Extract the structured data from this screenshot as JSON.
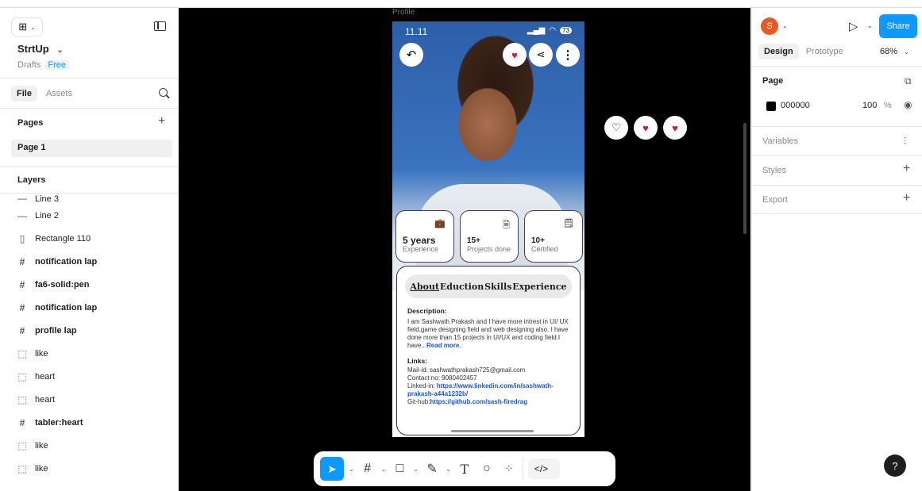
{
  "left_panel": {
    "project_name": "StrtUp",
    "project_caret": "⌄",
    "drafts_label": "Drafts",
    "plan_badge": "Free",
    "tabs": [
      "File",
      "Assets"
    ],
    "pages_title": "Pages",
    "page_item": "Page 1",
    "layers_title": "Layers",
    "layers": [
      {
        "icon": "—",
        "label": "Line 3",
        "bold": false
      },
      {
        "icon": "—",
        "label": "Line 2",
        "bold": false
      },
      {
        "icon": "▯",
        "label": "Rectangle 110",
        "bold": false
      },
      {
        "icon": "#",
        "label": "notification lap",
        "bold": true
      },
      {
        "icon": "#",
        "label": "fa6-solid:pen",
        "bold": true
      },
      {
        "icon": "#",
        "label": "notification lap",
        "bold": true
      },
      {
        "icon": "#",
        "label": "profile lap",
        "bold": true
      },
      {
        "icon": "⬚",
        "label": "like",
        "bold": false
      },
      {
        "icon": "⬚",
        "label": "heart",
        "bold": false
      },
      {
        "icon": "⬚",
        "label": "heart",
        "bold": false
      },
      {
        "icon": "#",
        "label": "tabler:heart",
        "bold": true
      },
      {
        "icon": "⬚",
        "label": "like",
        "bold": false
      },
      {
        "icon": "⬚",
        "label": "like",
        "bold": false
      }
    ]
  },
  "canvas": {
    "frame_label": "Profile",
    "status_time": "11.11",
    "battery": "73",
    "stats": [
      {
        "value": "5 years",
        "label": "Experience",
        "icon": "briefcase-icon",
        "glyph": "💼"
      },
      {
        "value": "15+",
        "label": "Projects done",
        "icon": "document-icon",
        "glyph": "🗎"
      },
      {
        "value": "10+",
        "label": "Certified",
        "icon": "certificate-icon",
        "glyph": "🗒"
      }
    ],
    "segment_tabs": [
      "About",
      "Eduction",
      "Skills",
      "Experience"
    ],
    "description_heading": "Description:",
    "description_text": "I am Sashwath Prakash and I have more intrest in UI/ UX field,game designing field and web designing also. I have done more than 15 projects in UI/UX and coding field.I have...",
    "read_more": "Read more.",
    "links_heading": "Links:",
    "mail": "Mail-id: sashwathprakash725@gmail.com",
    "contact": "Contact no: 9080402457",
    "linkedin_prefix": "Linked-in: ",
    "linkedin_url": "https://www.linkedin.com/in/sashwath-prakash-a44a1232b/",
    "github_prefix": "Git-hub:",
    "github_url": "https://github.com/sash-firedrag"
  },
  "toolbar": {
    "tools": [
      "move-tool",
      "frame-tool",
      "shape-tool",
      "pen-tool",
      "text-tool",
      "comment-tool",
      "actions-tool",
      "dev-mode-toggle"
    ]
  },
  "right_panel": {
    "avatar_letter": "S",
    "share_label": "Share",
    "tabs": [
      "Design",
      "Prototype"
    ],
    "zoom": "68%",
    "page_section": "Page",
    "page_color_hex": "000000",
    "page_opacity": "100",
    "percent_sign": "%",
    "variables_label": "Variables",
    "styles_label": "Styles",
    "export_label": "Export",
    "help_label": "?"
  },
  "colors": {
    "accent": "#0d99ff",
    "avatar": "#e85a23",
    "heart": "#d9152c",
    "link": "#1a56d6"
  }
}
